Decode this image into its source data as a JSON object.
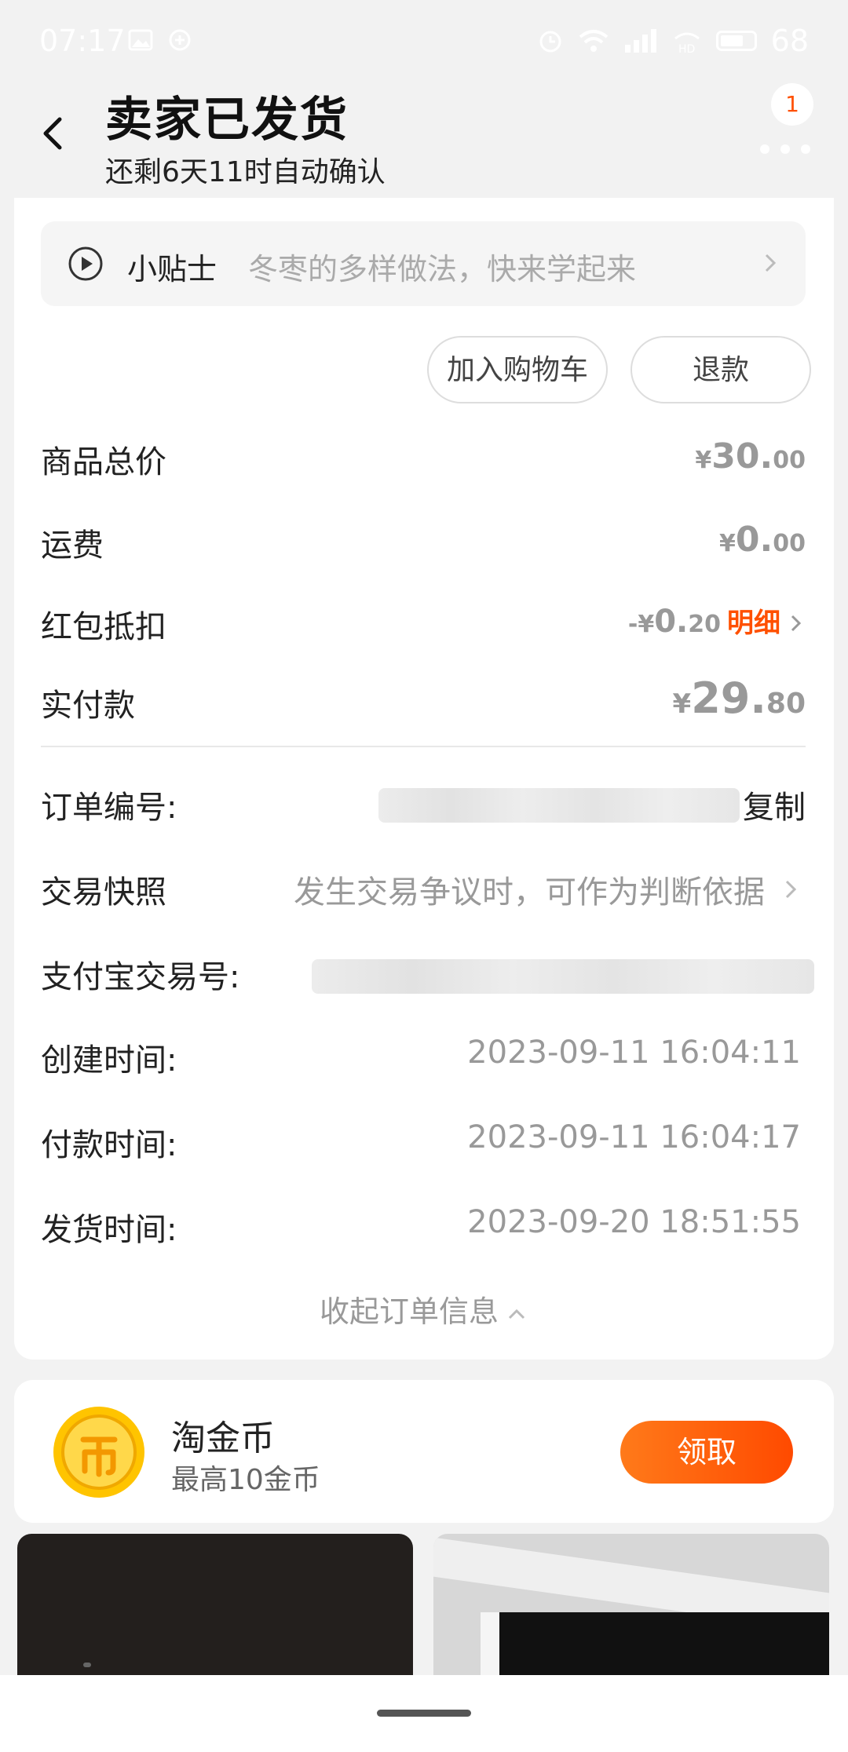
{
  "status_bar": {
    "time": "07:17",
    "battery": "68"
  },
  "header": {
    "title": "卖家已发货",
    "subtitle": "还剩6天11时自动确认",
    "badge_count": "1"
  },
  "tips": {
    "label": "小贴士",
    "text": "冬枣的多样做法，快来学起来"
  },
  "actions": {
    "add_to_cart": "加入购物车",
    "refund": "退款"
  },
  "price_rows": {
    "goods_total": {
      "label": "商品总价",
      "cur": "¥",
      "int": "30.",
      "dec": "00"
    },
    "shipping": {
      "label": "运费",
      "cur": "¥",
      "int": "0.",
      "dec": "00"
    },
    "red_packet": {
      "label": "红包抵扣",
      "cur": "-¥",
      "int": "0.",
      "dec": "20",
      "detail": "明细"
    },
    "paid": {
      "label": "实付款",
      "cur": "¥",
      "int": "29.",
      "dec": "80"
    }
  },
  "order_info": {
    "order_no_label": "订单编号:",
    "copy": "复制",
    "snapshot_label": "交易快照",
    "snapshot_text": "发生交易争议时，可作为判断依据",
    "alipay_label": "支付宝交易号:",
    "created_label": "创建时间:",
    "created_value": "2023-09-11 16:04:11",
    "paid_label": "付款时间:",
    "paid_value": "2023-09-11 16:04:17",
    "shipped_label": "发货时间:",
    "shipped_value": "2023-09-20 18:51:55",
    "collapse": "收起订单信息"
  },
  "coin": {
    "title": "淘金币",
    "subtitle": "最高10金币",
    "button": "领取"
  },
  "colors": {
    "accent": "#ff5000",
    "background": "#f2f2f2"
  }
}
